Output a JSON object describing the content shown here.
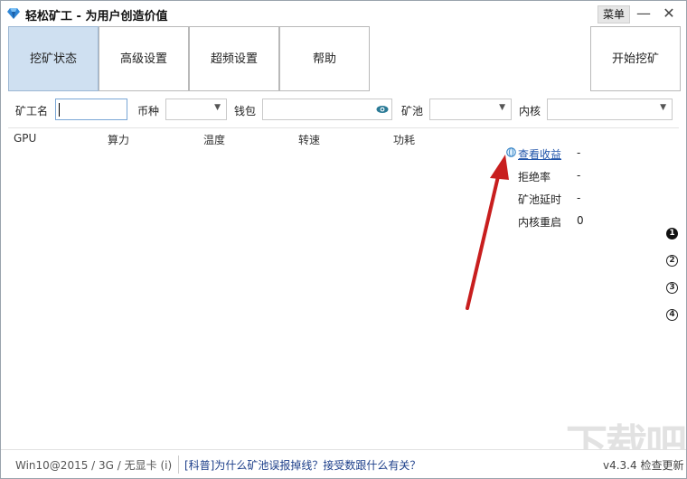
{
  "titlebar": {
    "title": "轻松矿工 - 为用户创造价值",
    "menu_label": "菜单",
    "minimize_glyph": "—",
    "close_glyph": "✕"
  },
  "toolbar": {
    "tabs": [
      {
        "label": "挖矿状态",
        "active": true
      },
      {
        "label": "高级设置",
        "active": false
      },
      {
        "label": "超频设置",
        "active": false
      },
      {
        "label": "帮助",
        "active": false
      }
    ],
    "start_label": "开始挖矿"
  },
  "form": {
    "miner_name_label": "矿工名",
    "miner_name_value": "",
    "coin_label": "币种",
    "coin_value": "",
    "wallet_label": "钱包",
    "wallet_value": "",
    "pool_label": "矿池",
    "pool_value": "",
    "kernel_label": "内核",
    "kernel_value": ""
  },
  "gpu_table": {
    "columns": [
      "GPU",
      "算力",
      "温度",
      "转速",
      "功耗"
    ]
  },
  "stats": {
    "earnings_link": "查看收益",
    "earnings_value": "-",
    "reject_rate_label": "拒绝率",
    "reject_rate_value": "-",
    "pool_latency_label": "矿池延时",
    "pool_latency_value": "-",
    "kernel_restart_label": "内核重启",
    "kernel_restart_value": "0"
  },
  "page_indicators": [
    "1",
    "2",
    "3",
    "4"
  ],
  "statusbar": {
    "system_info": "Win10@2015 / 3G / 无显卡 (i)",
    "news_link": "[科普]为什么矿池误报掉线？接受数跟什么有关？",
    "version": "v4.3.4 检查更新"
  },
  "colors": {
    "active_tab": "#cfe0f1",
    "link": "#2255aa",
    "arrow": "#c81e1e"
  }
}
